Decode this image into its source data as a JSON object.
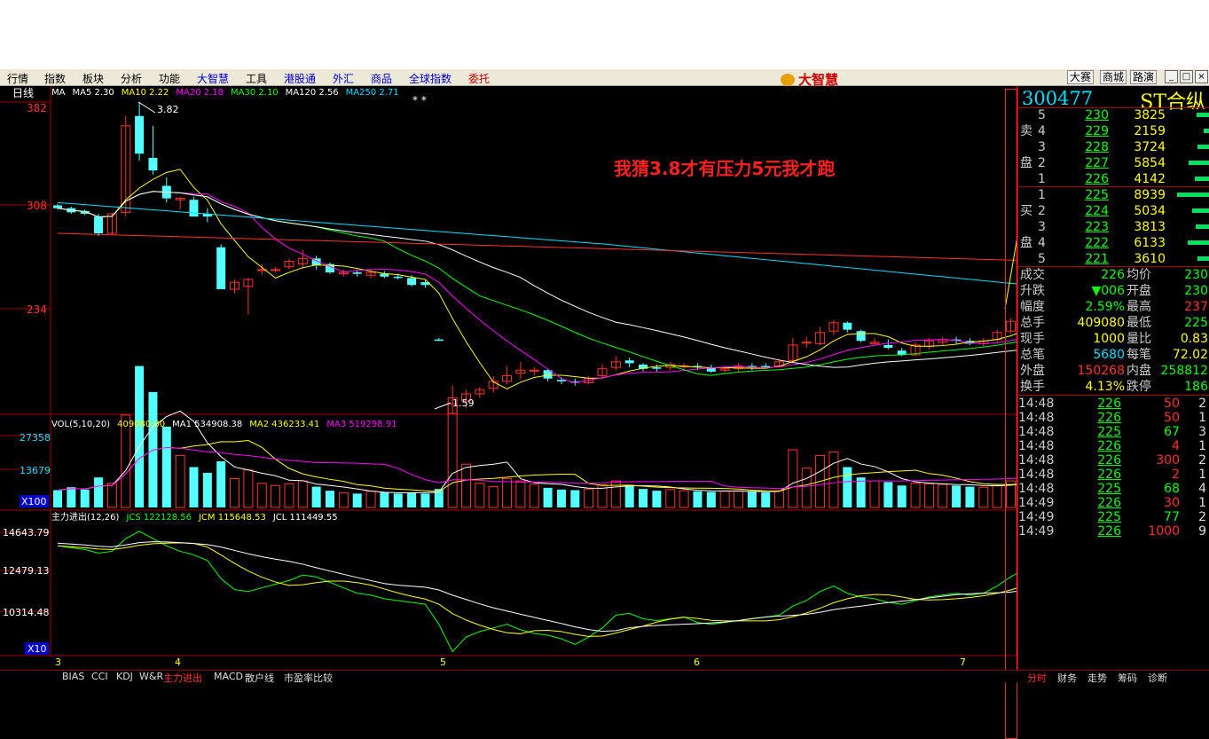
{
  "menu": {
    "items": [
      {
        "label": "行情",
        "color": "black"
      },
      {
        "label": "指数",
        "color": "black"
      },
      {
        "label": "板块",
        "color": "black"
      },
      {
        "label": "分析",
        "color": "black"
      },
      {
        "label": "功能",
        "color": "black"
      },
      {
        "label": "大智慧",
        "color": "blue"
      },
      {
        "label": "工具",
        "color": "black"
      },
      {
        "label": "港股通",
        "color": "blue"
      },
      {
        "label": "外汇",
        "color": "blue"
      },
      {
        "label": "商品",
        "color": "blue"
      },
      {
        "label": "全球指数",
        "color": "blue"
      },
      {
        "label": "委托",
        "color": "red"
      }
    ],
    "logo_text": "大智慧",
    "right_buttons": [
      "大赛",
      "商城",
      "路演"
    ],
    "window_buttons": [
      "_",
      "□",
      "×"
    ]
  },
  "chart": {
    "period_label": "日线",
    "ma_header": [
      {
        "text": "MA",
        "color": "#ffffff"
      },
      {
        "text": "MA5 2.30",
        "color": "#ffffff"
      },
      {
        "text": "MA10 2.22",
        "color": "#ffff00"
      },
      {
        "text": "MA20 2.18",
        "color": "#ff00ff"
      },
      {
        "text": "MA30 2.10",
        "color": "#00ff00"
      },
      {
        "text": "MA120 2.56",
        "color": "#ffffff"
      },
      {
        "text": "MA250 2.71",
        "color": "#00e0ff"
      }
    ],
    "ma_header2": "MA250 2.71",
    "price_ticks": [
      "382",
      "308",
      "234"
    ],
    "high_label": "3.82",
    "low_label": "1.59",
    "annotation": "我猜3.8才有压力5元我才跑",
    "vol_header": [
      {
        "text": "VOL(5,10,20)",
        "color": "#ffffff"
      },
      {
        "text": "409080.00",
        "color": "#ffff00"
      },
      {
        "text": "MA1 534908.38",
        "color": "#ffffff"
      },
      {
        "text": "MA2 436233.41",
        "color": "#ffff00"
      },
      {
        "text": "MA3 519298.91",
        "color": "#ff00ff"
      }
    ],
    "vol_ticks": [
      "27358",
      "13679"
    ],
    "vol_unit": "X100",
    "fund_header": [
      {
        "text": "主力进出(12,26)",
        "color": "#ffffff"
      },
      {
        "text": "JCS 122128.56",
        "color": "#00ff00"
      },
      {
        "text": "JCM 115648.53",
        "color": "#ffff00"
      },
      {
        "text": "JCL 111449.55",
        "color": "#ffffff"
      }
    ],
    "fund_ticks": [
      "14643.79",
      "12479.13",
      "10314.48"
    ],
    "fund_unit": "X10",
    "x_ticks": [
      "3",
      "4",
      "5",
      "6",
      "7"
    ]
  },
  "bottom_tabs": [
    "BIAS",
    "CCI",
    "KDJ",
    "W&R",
    "主力进出",
    "MACD",
    "散户线",
    "市盈率比较"
  ],
  "active_tab": "主力进出",
  "right_tabs": [
    "分时",
    "财务",
    "走势",
    "筹码",
    "诊断"
  ],
  "stock": {
    "code": "300477",
    "name": "ST合纵"
  },
  "order_book": {
    "sell_label": [
      "卖",
      "盘"
    ],
    "buy_label": [
      "买",
      "盘"
    ],
    "asks": [
      {
        "level": "5",
        "price": "230",
        "volume": "3825",
        "bar": 0.25
      },
      {
        "level": "4",
        "price": "229",
        "volume": "2159",
        "bar": 0.12
      },
      {
        "level": "3",
        "price": "228",
        "volume": "3724",
        "bar": 0.24
      },
      {
        "level": "2",
        "price": "227",
        "volume": "5854",
        "bar": 0.4
      },
      {
        "level": "1",
        "price": "226",
        "volume": "4142",
        "bar": 0.28
      }
    ],
    "bids": [
      {
        "level": "1",
        "price": "225",
        "volume": "8939",
        "bar": 0.62
      },
      {
        "level": "2",
        "price": "224",
        "volume": "5034",
        "bar": 0.34
      },
      {
        "level": "3",
        "price": "223",
        "volume": "3813",
        "bar": 0.26
      },
      {
        "level": "4",
        "price": "222",
        "volume": "6133",
        "bar": 0.42
      },
      {
        "level": "5",
        "price": "221",
        "volume": "3610",
        "bar": 0.24
      }
    ]
  },
  "stats": [
    {
      "k": "成交",
      "v": "226",
      "vc": "g",
      "k2": "均价",
      "v2": "230",
      "v2c": "g"
    },
    {
      "k": "升跌",
      "v": "▼006",
      "vc": "g",
      "k2": "开盘",
      "v2": "230",
      "v2c": "g"
    },
    {
      "k": "幅度",
      "v": "2.59%",
      "vc": "g",
      "k2": "最高",
      "v2": "237",
      "v2c": "r"
    },
    {
      "k": "总手",
      "v": "409080",
      "vc": "y",
      "k2": "最低",
      "v2": "225",
      "v2c": "g"
    },
    {
      "k": "现手",
      "v": "1000",
      "vc": "y",
      "k2": "量比",
      "v2": "0.83",
      "v2c": "y"
    },
    {
      "k": "总笔",
      "v": "5680",
      "vc": "c",
      "k2": "每笔",
      "v2": "72.02",
      "v2c": "y"
    },
    {
      "k": "外盘",
      "v": "150268",
      "vc": "r",
      "k2": "内盘",
      "v2": "258812",
      "v2c": "g"
    },
    {
      "k": "换手",
      "v": "4.13%",
      "vc": "y",
      "k2": "跌停",
      "v2": "186",
      "v2c": "g"
    }
  ],
  "ticks": [
    {
      "time": "14:48",
      "price": "226",
      "qty": "50",
      "qc": "r",
      "n": "2"
    },
    {
      "time": "14:48",
      "price": "226",
      "qty": "50",
      "qc": "r",
      "n": "1"
    },
    {
      "time": "14:48",
      "price": "225",
      "qty": "67",
      "qc": "g",
      "n": "3"
    },
    {
      "time": "14:48",
      "price": "226",
      "qty": "4",
      "qc": "r",
      "n": "1"
    },
    {
      "time": "14:48",
      "price": "226",
      "qty": "300",
      "qc": "r",
      "n": "2"
    },
    {
      "time": "14:48",
      "price": "226",
      "qty": "2",
      "qc": "r",
      "n": "1"
    },
    {
      "time": "14:48",
      "price": "225",
      "qty": "68",
      "qc": "g",
      "n": "4"
    },
    {
      "time": "14:49",
      "price": "226",
      "qty": "30",
      "qc": "r",
      "n": "1"
    },
    {
      "time": "14:49",
      "price": "225",
      "qty": "77",
      "qc": "g",
      "n": "2"
    },
    {
      "time": "14:49",
      "price": "226",
      "qty": "1000",
      "qc": "r",
      "n": "9"
    }
  ],
  "colors": {
    "up": "#ff3030",
    "down": "#54ffff",
    "grid": "#a00000"
  }
}
